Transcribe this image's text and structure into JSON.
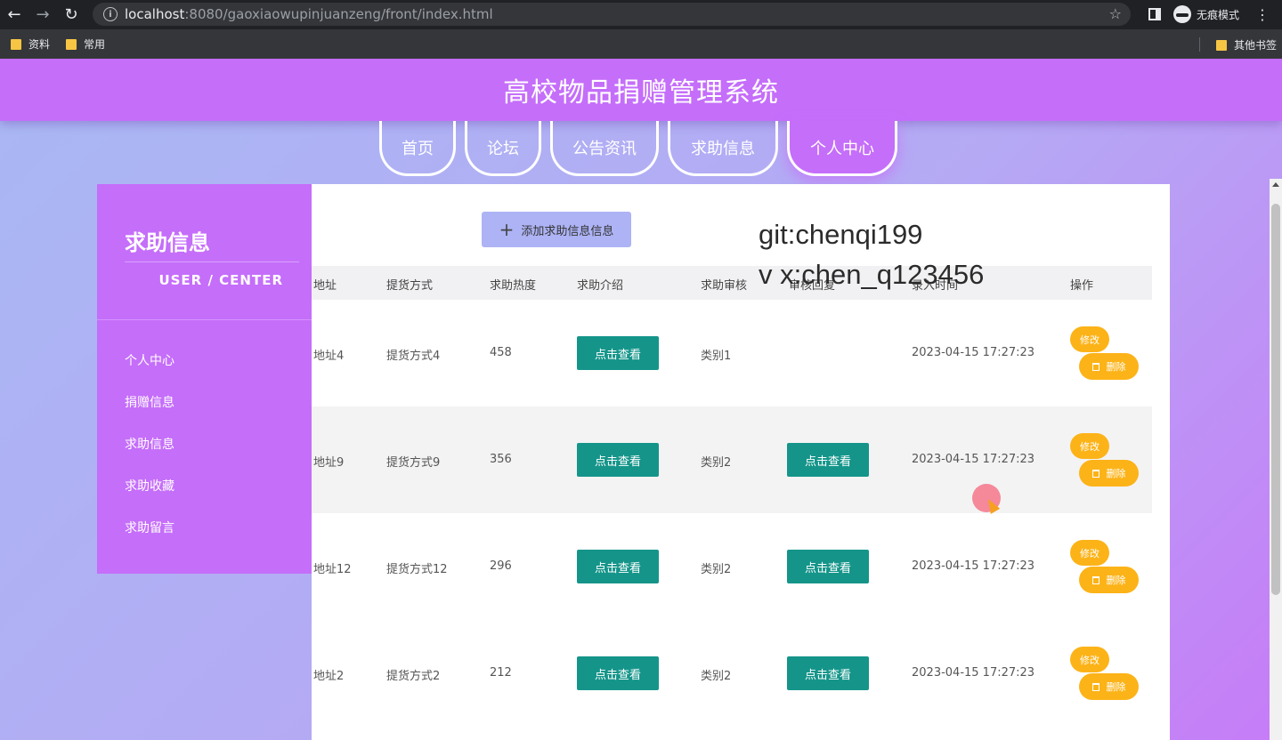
{
  "browser": {
    "url_host": "localhost",
    "url_path": ":8080/gaoxiaowupinjuanzeng/front/index.html",
    "incognito_label": "无痕模式",
    "bookmarks": [
      "资料",
      "常用"
    ],
    "other_bookmarks": "其他书签"
  },
  "header": {
    "title": "高校物品捐赠管理系统"
  },
  "nav": {
    "tabs": [
      "首页",
      "论坛",
      "公告资讯",
      "求助信息",
      "个人中心"
    ],
    "active": "个人中心"
  },
  "sidebar": {
    "title": "求助信息",
    "subtitle": "USER / CENTER",
    "items": [
      "个人中心",
      "捐赠信息",
      "求助信息",
      "求助收藏",
      "求助留言"
    ]
  },
  "toolbar": {
    "add_label": "添加求助信息信息"
  },
  "table": {
    "columns": [
      "地址",
      "提货方式",
      "求助热度",
      "求助介绍",
      "求助审核",
      "审核回复",
      "录入时间",
      "操作"
    ],
    "rows": [
      {
        "address": "地址4",
        "pickup": "提货方式4",
        "heat": "458",
        "intro": "点击查看",
        "category": "类别1",
        "reply": "",
        "time": "2023-04-15 17:27:23"
      },
      {
        "address": "地址9",
        "pickup": "提货方式9",
        "heat": "356",
        "intro": "点击查看",
        "category": "类别2",
        "reply": "点击查看",
        "time": "2023-04-15 17:27:23"
      },
      {
        "address": "地址12",
        "pickup": "提货方式12",
        "heat": "296",
        "intro": "点击查看",
        "category": "类别2",
        "reply": "点击查看",
        "time": "2023-04-15 17:27:23"
      },
      {
        "address": "地址2",
        "pickup": "提货方式2",
        "heat": "212",
        "intro": "点击查看",
        "category": "类别2",
        "reply": "点击查看",
        "time": "2023-04-15 17:27:23"
      }
    ],
    "edit_label": "修改",
    "delete_label": "删除"
  },
  "watermark": [
    "git:chenqi199",
    "v x:chen_q123456"
  ],
  "colors": {
    "header": "#c56efa",
    "view_button": "#15958a",
    "action_button": "#fcb318",
    "add_button": "#adb3f5"
  }
}
